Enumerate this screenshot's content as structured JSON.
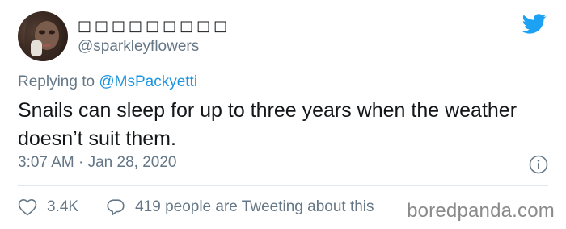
{
  "author": {
    "display_name_glyphs": [
      "□",
      "□",
      "□",
      "□",
      "□",
      "□",
      "□",
      "□",
      "□"
    ],
    "handle": "@sparkleyflowers"
  },
  "reply": {
    "prefix": "Replying to ",
    "mention": "@MsPackyetti"
  },
  "tweet": {
    "text": "Snails can sleep for up to three years when the weather doesn’t suit them.",
    "timestamp": "3:07 AM · Jan 28, 2020"
  },
  "actions": {
    "like_count": "3.4K",
    "tweeting_text": "419 people are Tweeting about this"
  },
  "watermark": "boredpanda.com",
  "colors": {
    "brand_blue": "#1da1f2",
    "mention_blue": "#1b95e0",
    "secondary_text": "#657786",
    "divider": "#e1e8ed"
  },
  "icons": {
    "brand": "twitter-bird-icon",
    "info": "info-icon",
    "like": "heart-icon",
    "reply": "speech-bubble-icon"
  }
}
